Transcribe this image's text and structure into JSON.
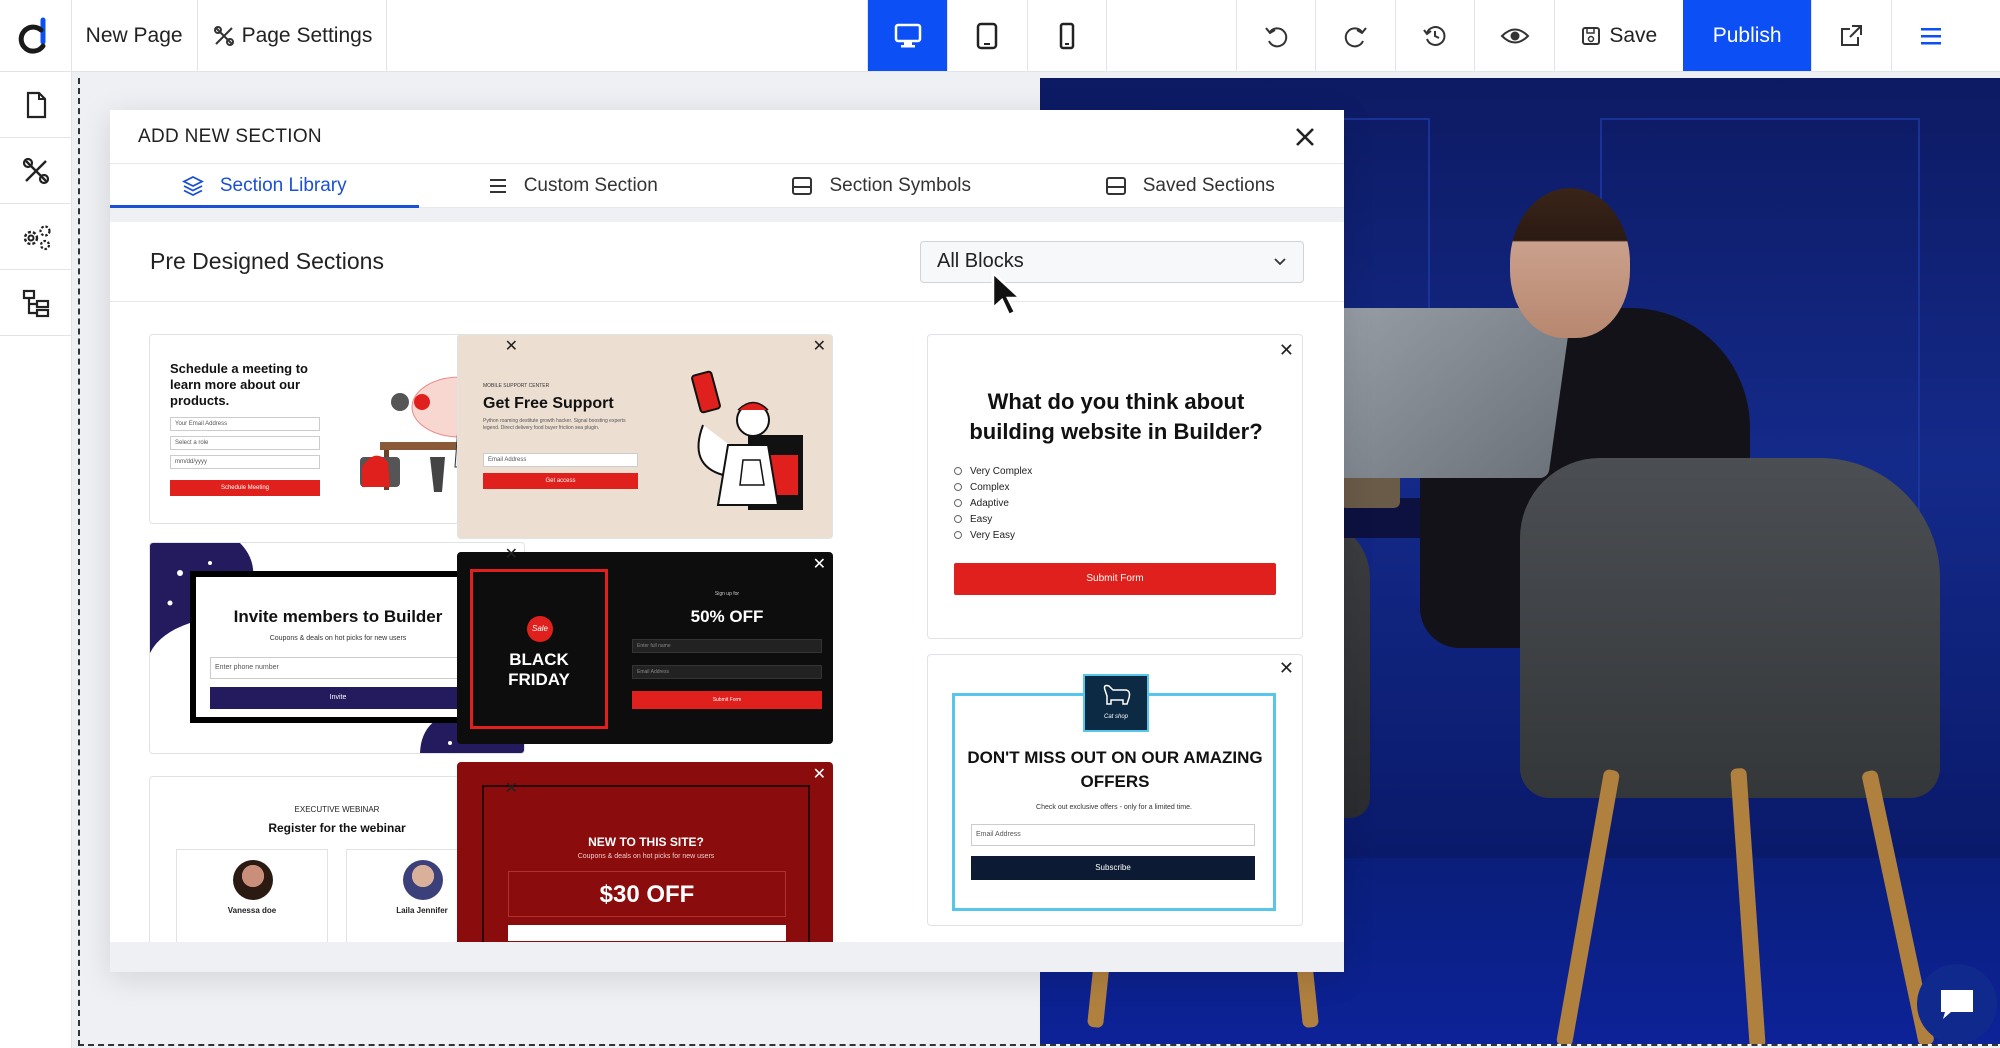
{
  "toolbar": {
    "page_name": "New Page",
    "page_settings": "Page Settings",
    "save": "Save",
    "publish": "Publish"
  },
  "icons": {
    "logo": "builder-logo-icon",
    "desktop": "desktop-icon",
    "tablet": "tablet-icon",
    "mobile": "mobile-icon",
    "undo": "undo-icon",
    "redo": "redo-icon",
    "history": "history-icon",
    "preview": "eye-icon",
    "external": "external-link-icon",
    "menu": "hamburger-menu-icon"
  },
  "colors": {
    "accent": "#0b4ff5",
    "tab_active": "#1a4fd6",
    "red": "#e0201c"
  },
  "modal": {
    "title": "ADD NEW SECTION",
    "tabs": [
      {
        "label": "Section Library",
        "active": true
      },
      {
        "label": "Custom Section",
        "active": false
      },
      {
        "label": "Section Symbols",
        "active": false
      },
      {
        "label": "Saved Sections",
        "active": false
      }
    ],
    "heading": "Pre Designed Sections",
    "filter": "All Blocks"
  },
  "cards": {
    "meeting": {
      "title": "Schedule a meeting to learn more about our products.",
      "email": "Your Email Address",
      "role": "Select a role",
      "date": "mm/dd/yyyy",
      "button": "Schedule Meeting"
    },
    "support": {
      "eyebrow": "MOBILE SUPPORT CENTER",
      "title": "Get Free Support",
      "desc": "Python roaming destitute growth hacker. Signal boosting experts legend. Direct delivery food buyer friction sea plugin.",
      "email": "Email Address",
      "button": "Get access"
    },
    "survey": {
      "title": "What do you think about building website in Builder?",
      "options": [
        "Very Complex",
        "Complex",
        "Adaptive",
        "Easy",
        "Very Easy"
      ],
      "button": "Submit Form"
    },
    "invite": {
      "title": "Invite members to Builder",
      "subtitle": "Coupons & deals on hot picks for new users",
      "phone": "Enter phone number",
      "button": "Invite"
    },
    "blackfriday": {
      "badge": "Sale",
      "title_1": "BLACK",
      "title_2": "FRIDAY",
      "eyebrow": "Sign up for",
      "offer": "50% OFF",
      "name": "Enter full name",
      "email": "Email Address",
      "button": "Submit Form"
    },
    "offers": {
      "logo_text": "Cat shop",
      "title": "DON'T MISS OUT ON OUR AMAZING OFFERS",
      "subtitle": "Check out exclusive offers - only for a limited time.",
      "email": "Email Address",
      "button": "Subscribe"
    },
    "webinar": {
      "eyebrow": "EXECUTIVE WEBINAR",
      "title": "Register for the webinar",
      "speaker_1": "Vanessa doe",
      "speaker_2": "Laila Jennifer"
    },
    "newsite": {
      "title": "NEW TO THIS SITE?",
      "subtitle": "Coupons & deals on hot picks for new users",
      "offer": "$30 OFF"
    }
  }
}
